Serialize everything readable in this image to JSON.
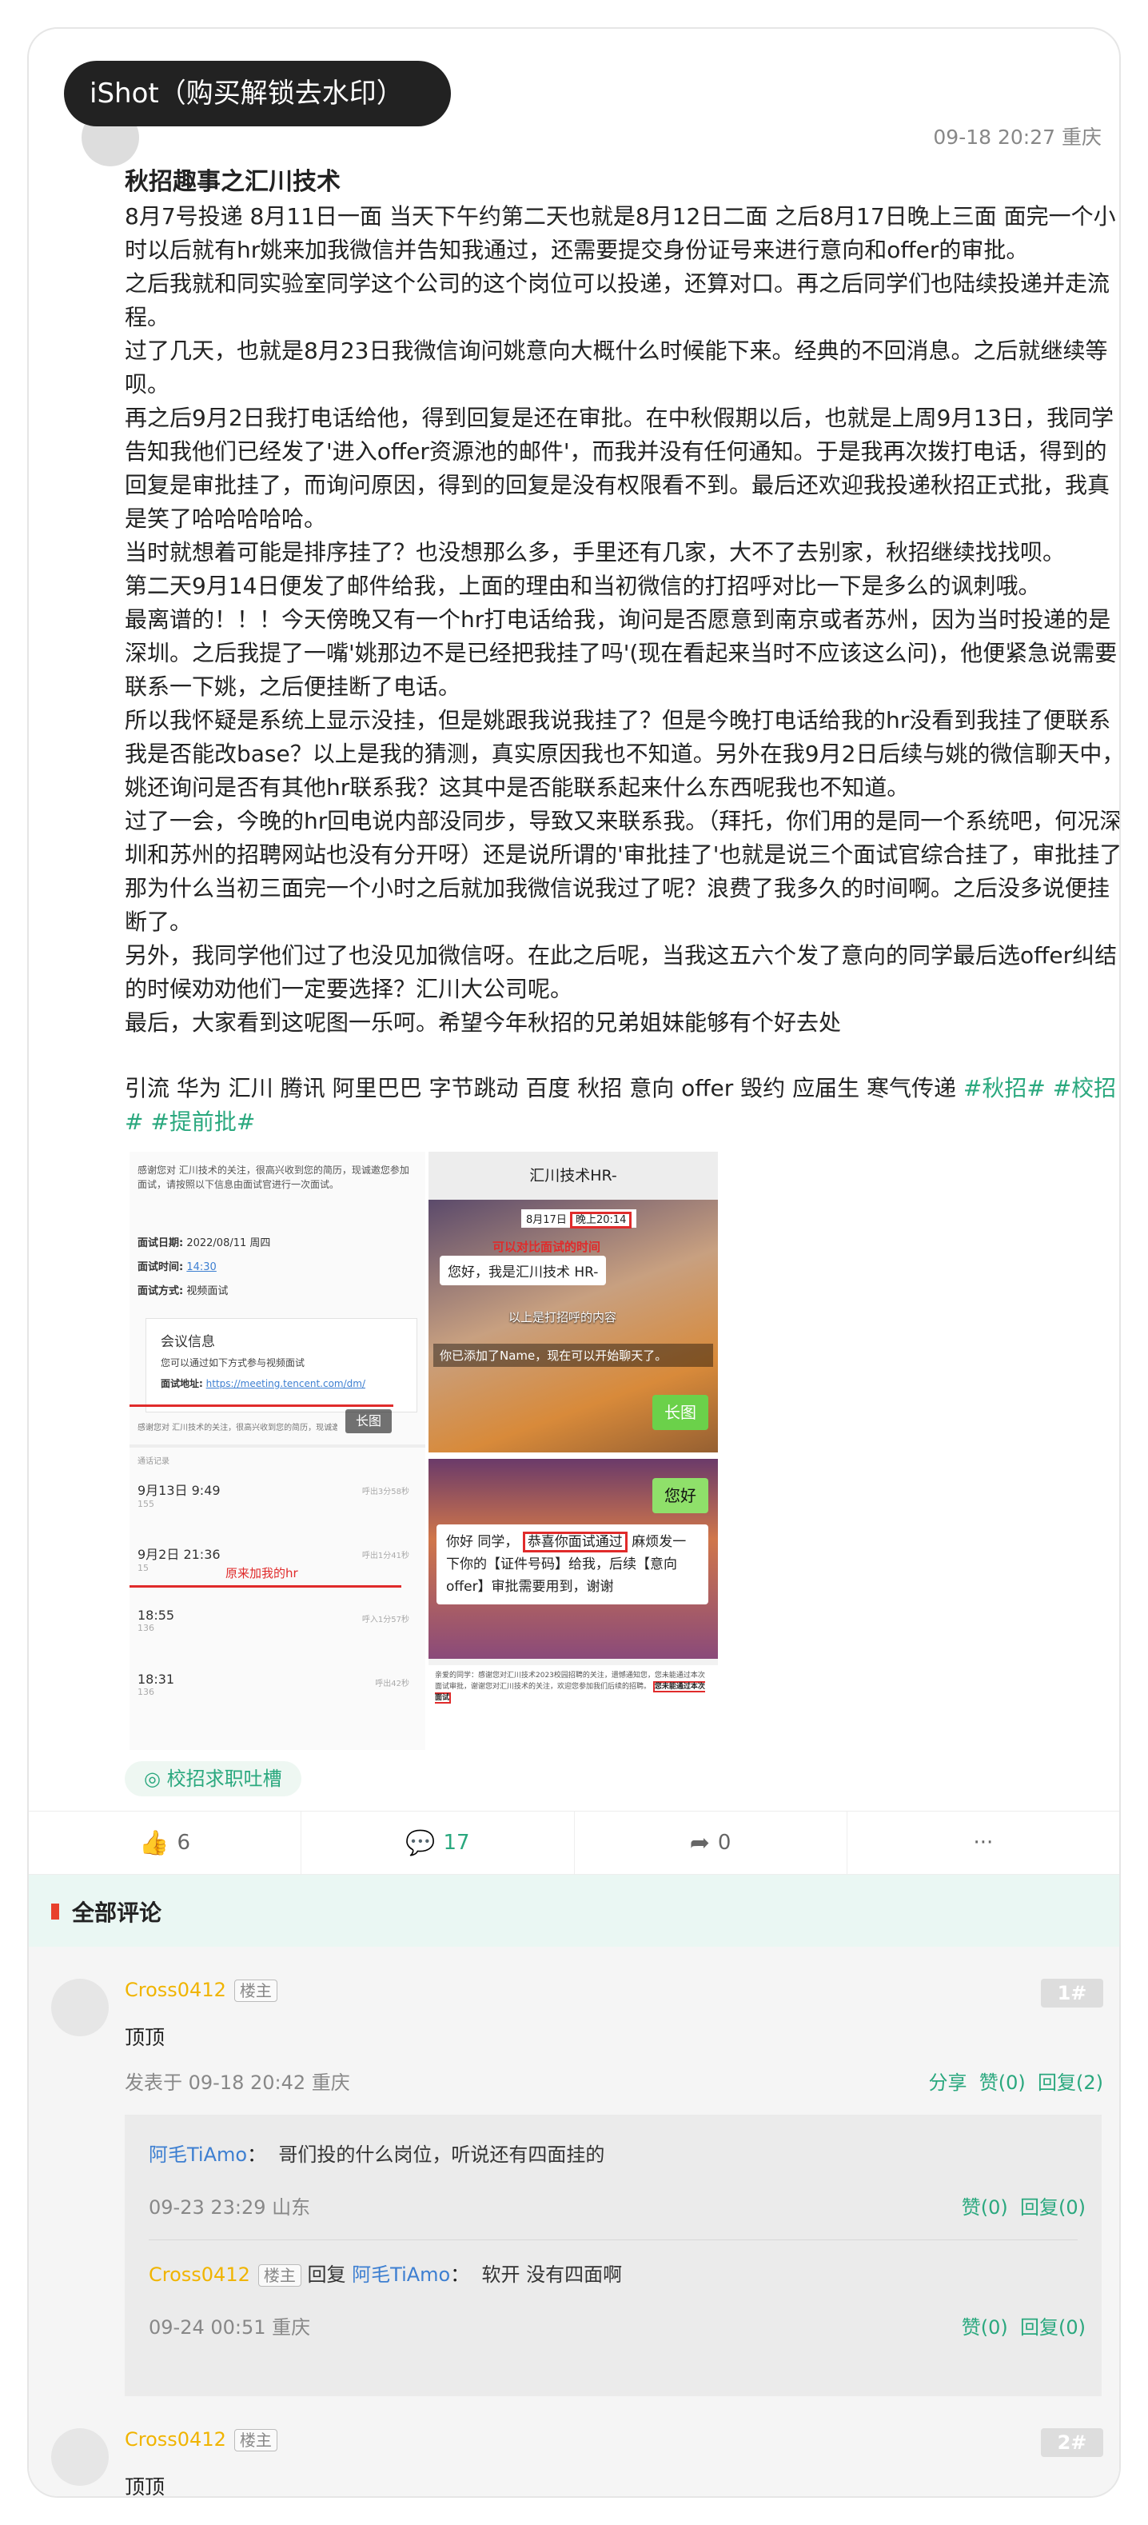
{
  "watermark": "iShot（购买解锁去水印）",
  "post": {
    "meta": "09-18 20:27 重庆",
    "title": "秋招趣事之汇川技术",
    "paragraphs": [
      "8月7号投递  8月11日一面 当天下午约第二天也就是8月12日二面  之后8月17日晚上三面  面完一个小时以后就有hr姚来加我微信并告知我通过，还需要提交身份证号来进行意向和offer的审批。",
      "之后我就和同实验室同学这个公司的这个岗位可以投递，还算对口。再之后同学们也陆续投递并走流程。",
      "过了几天，也就是8月23日我微信询问姚意向大概什么时候能下来。经典的不回消息。之后就继续等呗。",
      "再之后9月2日我打电话给他，得到回复是还在审批。在中秋假期以后，也就是上周9月13日，我同学告知我他们已经发了'进入offer资源池的邮件'，而我并没有任何通知。于是我再次拨打电话，得到的回复是审批挂了，而询问原因，得到的回复是没有权限看不到。最后还欢迎我投递秋招正式批，我真是笑了哈哈哈哈哈。",
      "当时就想着可能是排序挂了？也没想那么多，手里还有几家，大不了去别家，秋招继续找找呗。",
      "第二天9月14日便发了邮件给我，上面的理由和当初微信的打招呼对比一下是多么的讽刺哦。",
      "最离谱的！！！今天傍晚又有一个hr打电话给我，询问是否愿意到南京或者苏州，因为当时投递的是深圳。之后我提了一嘴'姚那边不是已经把我挂了吗'(现在看起来当时不应该这么问)，他便紧急说需要联系一下姚，之后便挂断了电话。",
      "所以我怀疑是系统上显示没挂，但是姚跟我说我挂了？但是今晚打电话给我的hr没看到我挂了便联系我是否能改base？以上是我的猜测，真实原因我也不知道。另外在我9月2日后续与姚的微信聊天中，姚还询问是否有其他hr联系我？这其中是否能联系起来什么东西呢我也不知道。",
      "过了一会，今晚的hr回电说内部没同步，导致又来联系我。（拜托，你们用的是同一个系统吧，何况深圳和苏州的招聘网站也没有分开呀）还是说所谓的'审批挂了'也就是说三个面试官综合挂了，审批挂了那为什么当初三面完一个小时之后就加我微信说我过了呢？浪费了我多久的时间啊。之后没多说便挂断了。",
      "另外，我同学他们过了也没见加微信呀。在此之后呢，当我这五六个发了意向的同学最后选offer纠结的时候劝劝他们一定要选择？汇川大公司呢。",
      "最后，大家看到这呢图一乐呵。希望今年秋招的兄弟姐妹能够有个好去处"
    ],
    "tags_plain": "引流 华为 汇川 腾讯 阿里巴巴 字节跳动 百度 秋招 意向 offer 毁约 应届生 寒气传递 ",
    "tags_green_1": "#秋招# #校招",
    "tags_green_2": "# #提前批#",
    "topic_chip": "校招求职吐槽",
    "likes": "6",
    "comments": "17",
    "shares": "0",
    "more": "···"
  },
  "image_a": {
    "intro": "感谢您对 汇川技术的关注，很高兴收到您的简历，现诚邀您参加面试，请按照以下信息由面试官进行一次面试。",
    "date_label": "面试日期:",
    "date_value": "2022/08/11 周四",
    "time_label": "面试时间:",
    "time_value": "14:30",
    "mode_label": "面试方式:",
    "mode_value": "视频面试",
    "meeting_title": "会议信息",
    "meeting_hint": "您可以通过如下方式参与视频面试",
    "meeting_addr_label": "面试地址:",
    "meeting_addr_value": "https://meeting.tencent.com/dm/",
    "long_image": "长图",
    "email_tail": "感谢您对 汇川技术的关注，很高兴收到您的简历，现诚邀您参加面试",
    "call_log_title": "通话记录",
    "calls": [
      {
        "time": "9月13日 9:49",
        "sub": "155",
        "dur": "呼出3分58秒"
      },
      {
        "time": "9月2日 21:36",
        "sub": "15",
        "dur": "呼出1分41秒"
      },
      {
        "time": "18:55",
        "sub": "136",
        "dur": "呼入1分57秒"
      },
      {
        "time": "18:31",
        "sub": "136",
        "dur": "呼出42秒"
      }
    ],
    "call_note": "原来加我的hr"
  },
  "image_b": {
    "chat_title": "汇川技术HR-",
    "chat_date": "8月17日",
    "chat_time": "晚上20:14",
    "annot_compare": "可以对比面试的时间",
    "msg_1": "您好，我是汇川技术 HR-",
    "annot_greet": "以上是打招呼的内容",
    "msg_added": "你已添加了Name，现在可以开始聊天了。",
    "long_image": "长图",
    "reply_hi": "您好",
    "msg_2_prefix": "你好",
    "msg_2_mid": "同学，",
    "msg_2_highlight": "恭喜你面试通过",
    "msg_2_rest": "麻烦发一下你的【证件号码】给我，后续【意向 offer】审批需要用到，谢谢",
    "email_snippet": "亲爱的同学：感谢您对汇川技术2023校园招聘的关注，遗憾通知您，您未能通过本次面试审批，谢谢您对汇川技术的关注，欢迎您参加我们后续的招聘。",
    "email_bold": "您未能通过本次面试"
  },
  "comments_section": {
    "title": "全部评论",
    "c1": {
      "name": "Cross0412",
      "badge": "楼主",
      "floor": "1#",
      "text": "顶顶",
      "time": "发表于 09-18 20:42 重庆",
      "share": "分享",
      "like": "赞(0)",
      "reply": "回复(2)"
    },
    "r1": {
      "name": "阿毛TiAmo",
      "colon": "：",
      "text": "哥们投的什么岗位，听说还有四面挂的",
      "time": "09-23 23:29 山东",
      "like": "赞(0)",
      "reply": "回复(0)"
    },
    "r2": {
      "name": "Cross0412",
      "badge": "楼主",
      "reply_word": "回复",
      "to": "阿毛TiAmo",
      "colon": "：",
      "text": "软开 没有四面啊",
      "time": "09-24 00:51 重庆",
      "like": "赞(0)",
      "reply": "回复(0)"
    },
    "c2": {
      "name": "Cross0412",
      "badge": "楼主",
      "floor": "2#",
      "text": "顶顶"
    }
  }
}
